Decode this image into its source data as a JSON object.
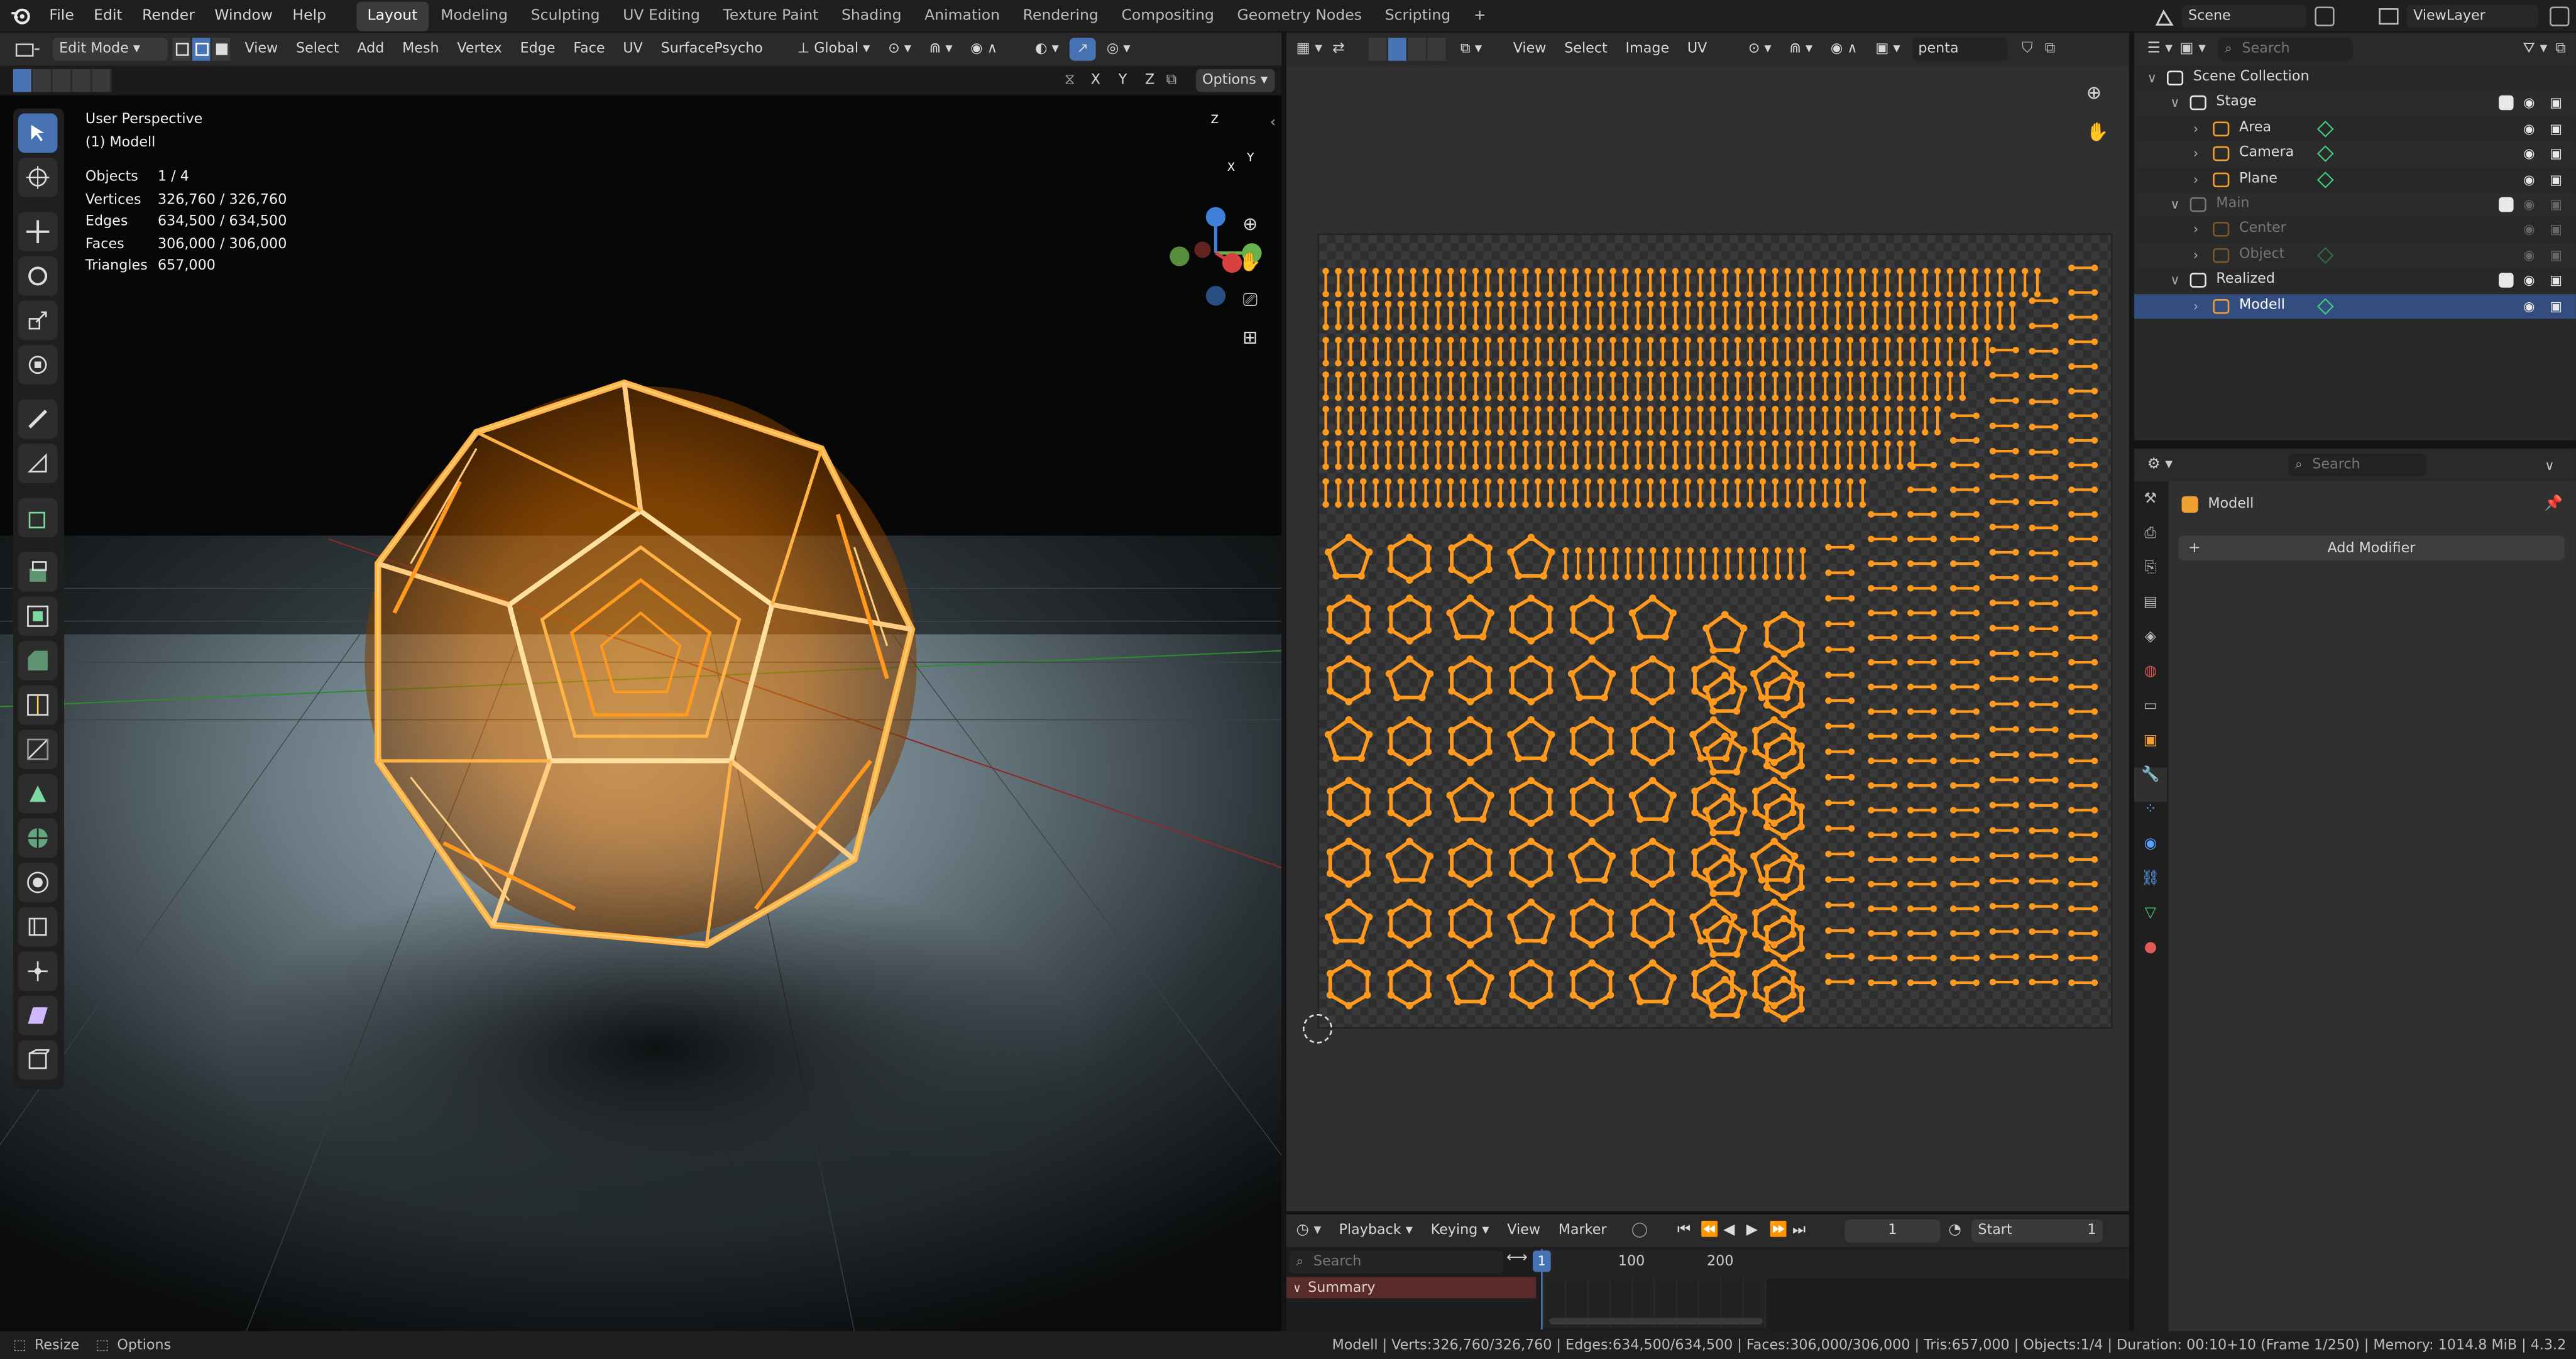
{
  "topbar": {
    "menus": [
      "File",
      "Edit",
      "Render",
      "Window",
      "Help"
    ],
    "workspaces": [
      "Layout",
      "Modeling",
      "Sculpting",
      "UV Editing",
      "Texture Paint",
      "Shading",
      "Animation",
      "Rendering",
      "Compositing",
      "Geometry Nodes",
      "Scripting"
    ],
    "active_workspace": "Layout",
    "add_tab": "+",
    "scene": "Scene",
    "view_layer": "ViewLayer"
  },
  "viewport": {
    "mode": "Edit Mode",
    "menus": [
      "View",
      "Select",
      "Add",
      "Mesh",
      "Vertex",
      "Edge",
      "Face",
      "UV",
      "SurfacePsycho"
    ],
    "orientation": "Global",
    "axes": [
      "X",
      "Y",
      "Z"
    ],
    "options": "Options",
    "perspective": "User Perspective",
    "object_label": "(1) Modell",
    "stats": [
      {
        "label": "Objects",
        "value": "1 / 4"
      },
      {
        "label": "Vertices",
        "value": "326,760 / 326,760"
      },
      {
        "label": "Edges",
        "value": "634,500 / 634,500"
      },
      {
        "label": "Faces",
        "value": "306,000 / 306,000"
      },
      {
        "label": "Triangles",
        "value": "657,000"
      }
    ],
    "gizmo": {
      "z": "Z",
      "y": "Y",
      "x": "X"
    }
  },
  "uv_editor": {
    "menus": [
      "View",
      "Select",
      "Image",
      "UV"
    ],
    "image_name": "penta"
  },
  "outliner": {
    "search_placeholder": "Search",
    "items": [
      {
        "label": "Scene Collection",
        "depth": 0,
        "kind": "collection",
        "dim": false,
        "selected": false
      },
      {
        "label": "Stage",
        "depth": 1,
        "kind": "collection",
        "dim": false,
        "selected": false
      },
      {
        "label": "Area",
        "depth": 2,
        "kind": "light",
        "dim": false,
        "selected": false
      },
      {
        "label": "Camera",
        "depth": 2,
        "kind": "camera",
        "dim": false,
        "selected": false
      },
      {
        "label": "Plane",
        "depth": 2,
        "kind": "mesh",
        "dim": false,
        "selected": false
      },
      {
        "label": "Main",
        "depth": 1,
        "kind": "collection",
        "dim": true,
        "selected": false
      },
      {
        "label": "Center",
        "depth": 2,
        "kind": "empty",
        "dim": true,
        "selected": false
      },
      {
        "label": "Object",
        "depth": 2,
        "kind": "mesh",
        "dim": true,
        "selected": false
      },
      {
        "label": "Realized",
        "depth": 1,
        "kind": "collection",
        "dim": false,
        "selected": false
      },
      {
        "label": "Modell",
        "depth": 2,
        "kind": "mesh",
        "dim": false,
        "selected": true
      }
    ]
  },
  "properties": {
    "search_placeholder": "Search",
    "object_name": "Modell",
    "add_modifier": "Add Modifier"
  },
  "timeline": {
    "menus": [
      "Playback",
      "Keying",
      "View",
      "Marker"
    ],
    "current_frame": "1",
    "start_label": "Start",
    "start_value": "1",
    "search_placeholder": "Search",
    "summary": "Summary",
    "ticks": [
      "1",
      "100",
      "200"
    ]
  },
  "status": {
    "left": [
      "Resize",
      "Options"
    ],
    "right": "Modell | Verts:326,760/326,760 | Edges:634,500/634,500 | Faces:306,000/306,000 | Tris:657,000 | Objects:1/4 | Duration: 00:10+10 (Frame 1/250) | Memory: 1014.8 MiB | 4.3.2"
  },
  "colors": {
    "accent": "#4772b3",
    "selected_orange": "#ff9a1f",
    "bg_dark": "#1d1d1d",
    "header": "#2a2a2a",
    "panel": "#303030",
    "summary_red": "#5a2b2b"
  },
  "icons": [
    "blender-logo-icon",
    "select-box-icon",
    "cursor-icon",
    "move-icon",
    "rotate-icon",
    "scale-icon",
    "transform-icon",
    "annotate-icon",
    "measure-icon",
    "add-cube-icon",
    "extrude-icon",
    "inset-icon",
    "bevel-icon",
    "loopcut-icon",
    "knife-icon",
    "polybuild-icon",
    "spin-icon",
    "smooth-icon",
    "edge-slide-icon",
    "shrink-icon",
    "shear-icon",
    "rip-icon",
    "zoom-icon",
    "hand-icon",
    "camera-icon",
    "grid-icon",
    "eye-icon",
    "checkbox-icon",
    "wrench-icon"
  ]
}
